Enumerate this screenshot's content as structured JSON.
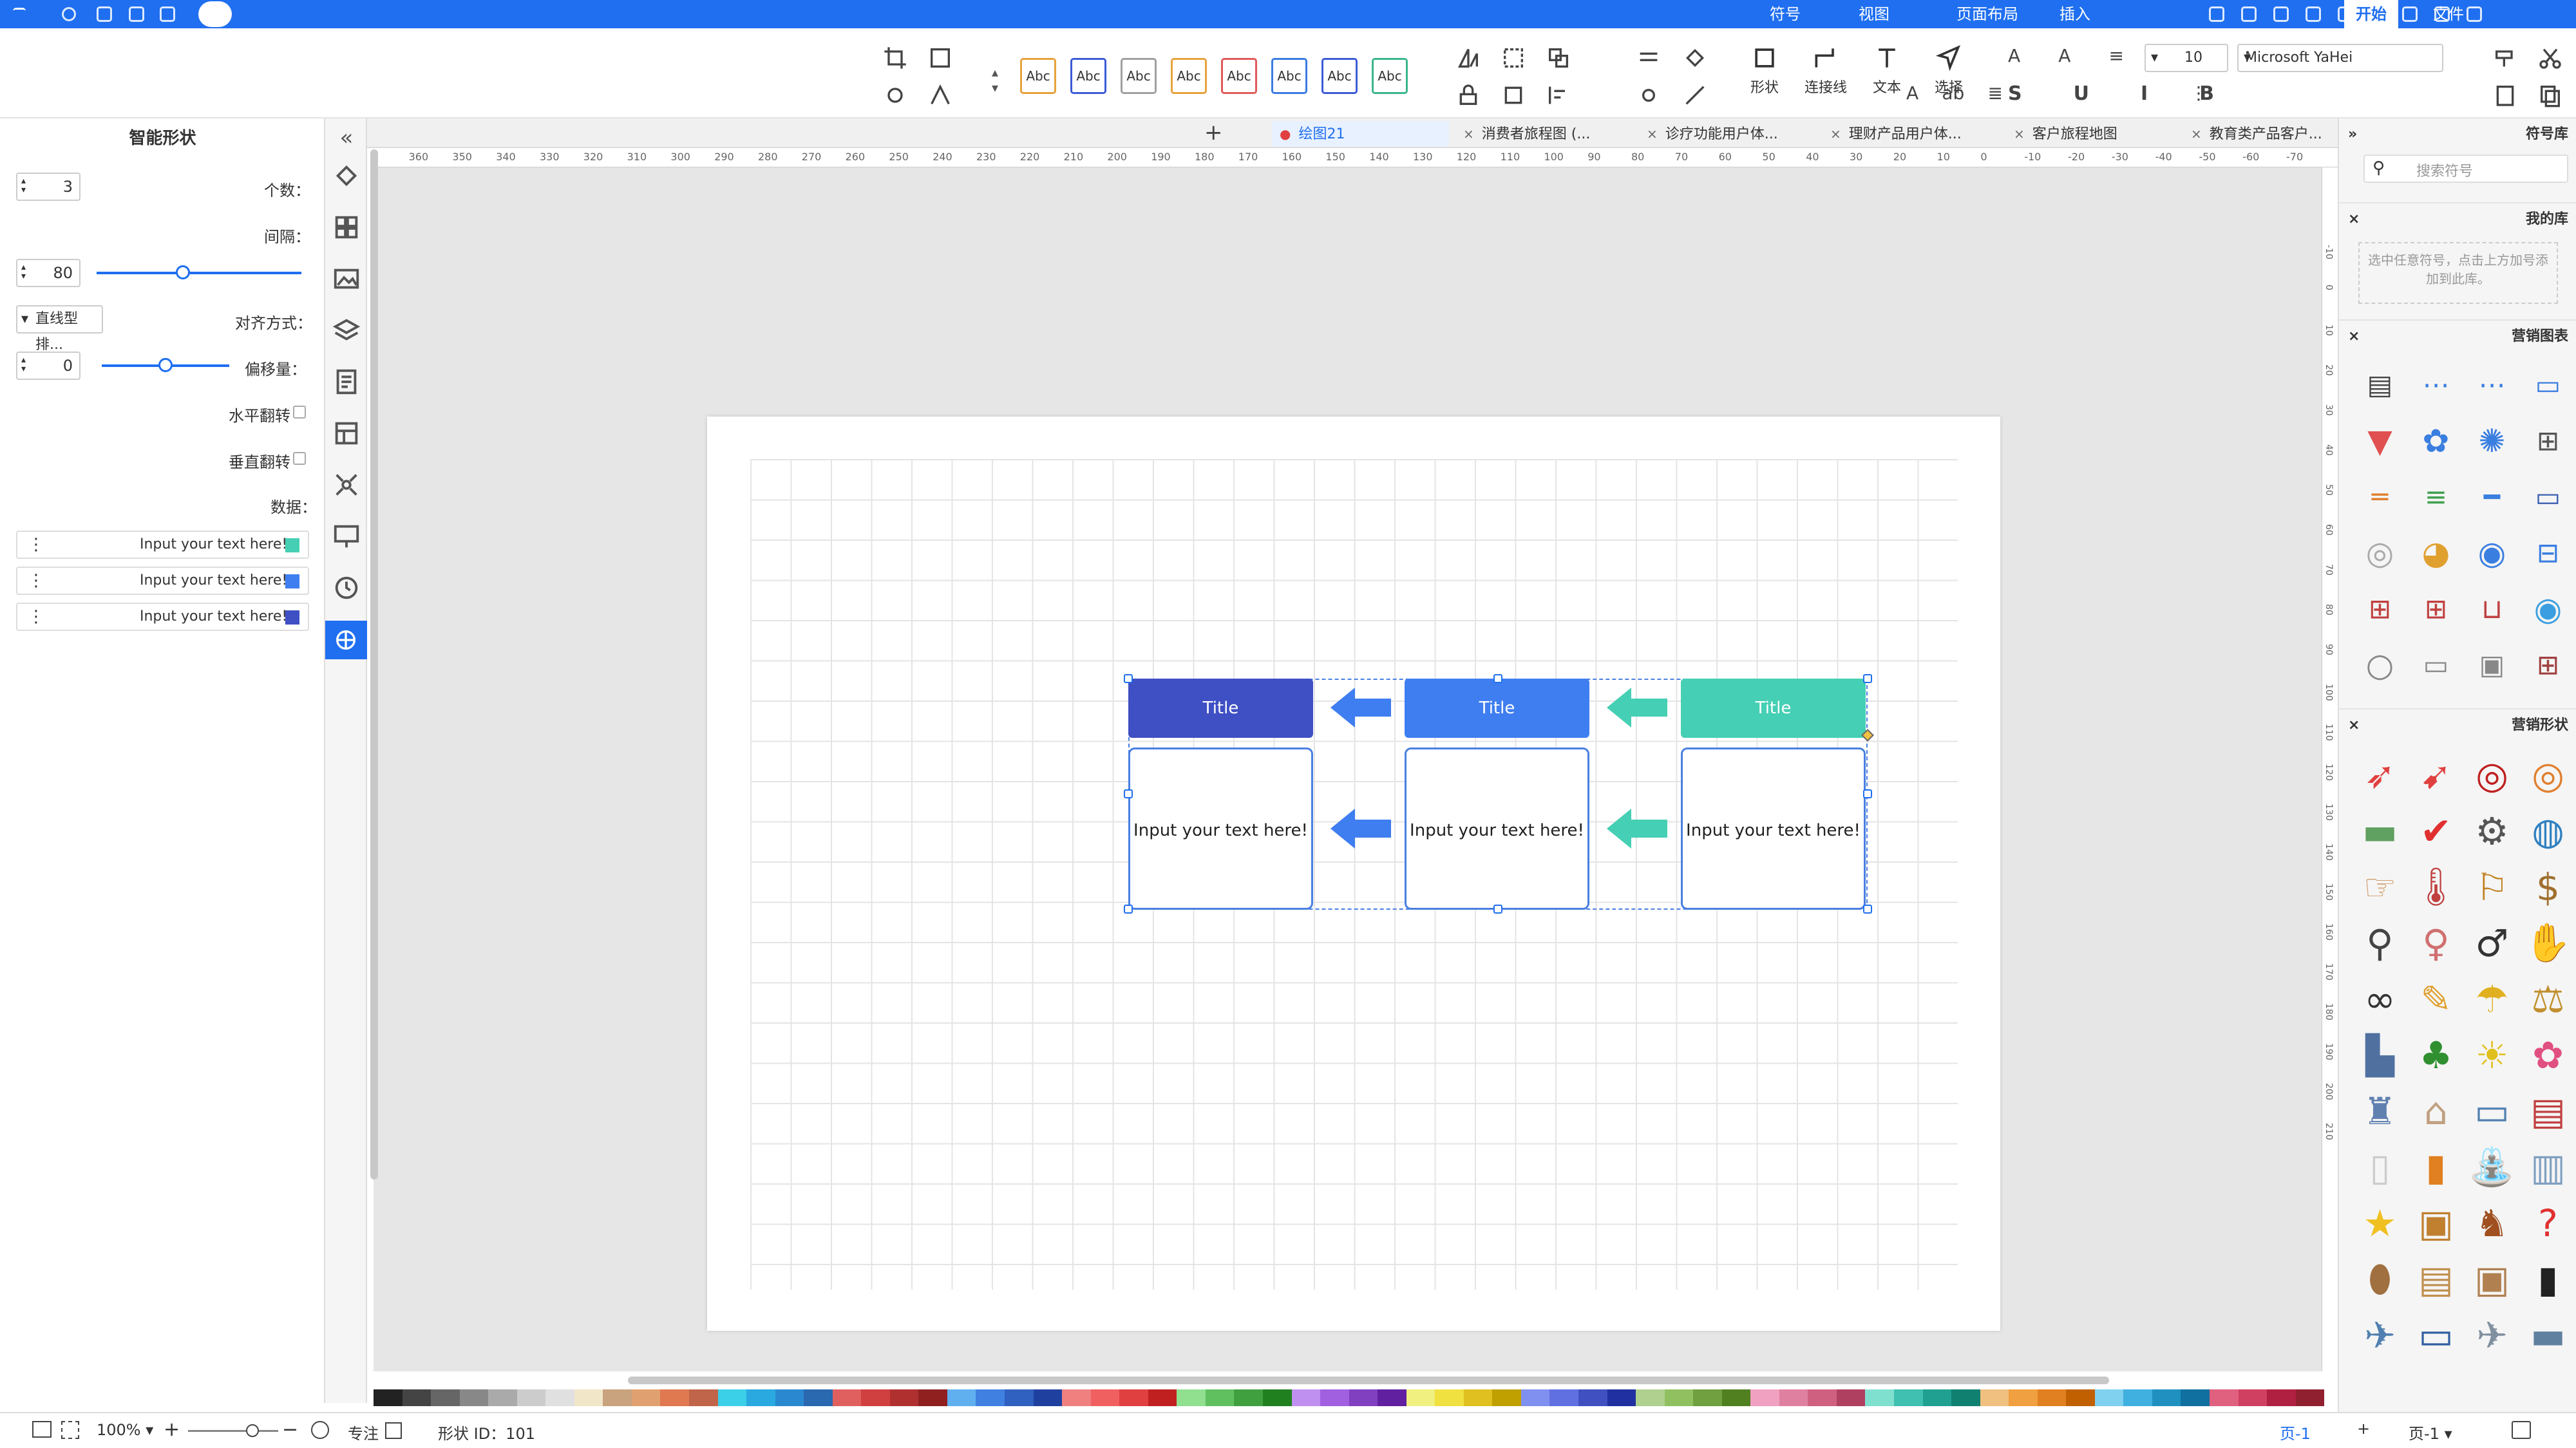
{
  "menu": {
    "tabs": [
      "文件",
      "开始",
      "符号",
      "插入",
      "页面布局",
      "视图"
    ],
    "active": "开始"
  },
  "ribbon": {
    "font_name": "Microsoft YaHei",
    "font_size": "10",
    "groups": [
      "选择",
      "文本",
      "连接线",
      "形状"
    ],
    "style_presets": [
      "Abc",
      "Abc",
      "Abc",
      "Abc",
      "Abc",
      "Abc",
      "Abc",
      "Abc"
    ],
    "preset_colors": [
      "#3bb58e",
      "#3c5bd6",
      "#3c7be0",
      "#e05a5a",
      "#e6a23c",
      "#a0a0a0",
      "#3c5bd6",
      "#e6a23c"
    ]
  },
  "left_panel": {
    "title": "智能形状",
    "count_label": "个数：",
    "count_value": "3",
    "gap_label": "间隔：",
    "gap_value": "80",
    "gap_fraction": 0.58,
    "align_label": "对齐方式：",
    "align_value": "直线型排...",
    "offset_label": "偏移量：",
    "offset_value": "0",
    "offset_fraction": 0.5,
    "hflip_label": "水平翻转",
    "vflip_label": "垂直翻转",
    "data_label": "数据：",
    "data_rows": [
      {
        "text": "Input your text here!",
        "color": "#45cfb4"
      },
      {
        "text": "Input your text here!",
        "color": "#3f7ef0"
      },
      {
        "text": "Input your text here!",
        "color": "#3f4fc4"
      }
    ]
  },
  "tabs": [
    {
      "label": "教育类产品客户..."
    },
    {
      "label": "客户旅程地图"
    },
    {
      "label": "理财产品用户体..."
    },
    {
      "label": "诊疗功能用户体..."
    },
    {
      "label": "消费者旅程图 (..."
    },
    {
      "label": "绘图21",
      "active": true
    }
  ],
  "ruler": {
    "top": [
      "-70",
      "-60",
      "-50",
      "-40",
      "-30",
      "-20",
      "-10",
      "0",
      "10",
      "20",
      "30",
      "40",
      "50",
      "60",
      "70",
      "80",
      "90",
      "100",
      "110",
      "120",
      "130",
      "140",
      "150",
      "160",
      "170",
      "180",
      "190",
      "200",
      "210",
      "220",
      "230",
      "240",
      "250",
      "260",
      "270",
      "280",
      "290",
      "300",
      "310",
      "320",
      "330",
      "340",
      "350",
      "360"
    ],
    "side": [
      "-10",
      "0",
      "10",
      "20",
      "30",
      "40",
      "50",
      "60",
      "70",
      "80",
      "90",
      "100",
      "110",
      "120",
      "130",
      "140",
      "150",
      "160",
      "170",
      "180",
      "190",
      "200",
      "210"
    ]
  },
  "diagram": {
    "titles": [
      {
        "text": "Title",
        "color": "#45cfb4"
      },
      {
        "text": "Title",
        "color": "#3f7ef0"
      },
      {
        "text": "Title",
        "color": "#3f4fc4"
      }
    ],
    "bodies": [
      "Input your text here!",
      "Input your text here!",
      "Input your text here!"
    ],
    "arrow_colors": [
      "#45cfb4",
      "#3f7ef0"
    ]
  },
  "right_panel": {
    "title": "符号库",
    "search_placeholder": "搜索符号",
    "my_lib": "我的库",
    "my_lib_hint": "选中任意符号，点击上方加号添加到此库。",
    "section1": "营销图表",
    "section2": "营销形状"
  },
  "status": {
    "page_label": "页-1",
    "page_name": "页-1",
    "shape_id": "形状 ID：101",
    "focus": "专注",
    "zoom": "100%"
  },
  "palette": [
    "#222222",
    "#444444",
    "#666666",
    "#888888",
    "#aaaaaa",
    "#cccccc",
    "#e0e0e0",
    "#f2e6c9",
    "#c9a27e",
    "#e0a070",
    "#e07850",
    "#c0654a",
    "#3bcfe8",
    "#2aa8e0",
    "#2a88d0",
    "#2a68b0",
    "#e06060",
    "#d04040",
    "#b03030",
    "#902020",
    "#60b0f0",
    "#4080e0",
    "#3060c0",
    "#2040a0",
    "#f08080",
    "#f06060",
    "#e04040",
    "#c02020",
    "#90e090",
    "#60c060",
    "#40a040",
    "#208020",
    "#c090f0",
    "#a060e0",
    "#8040c0",
    "#6020a0",
    "#f0f080",
    "#f0e040",
    "#e0c020",
    "#c0a000",
    "#8090f0",
    "#6070e0",
    "#4050c0",
    "#2030a0",
    "#b0d090",
    "#90c060",
    "#70a040",
    "#508020",
    "#f0a0c0",
    "#e080a0",
    "#d06080",
    "#b04060",
    "#80e0d0",
    "#40c0b0",
    "#20a090",
    "#108070",
    "#f0c080",
    "#f0a040",
    "#e08020",
    "#c06000",
    "#80d0f0",
    "#40b0e0",
    "#2090c0",
    "#1070a0",
    "#e06080",
    "#d04060",
    "#b02040",
    "#902030"
  ]
}
